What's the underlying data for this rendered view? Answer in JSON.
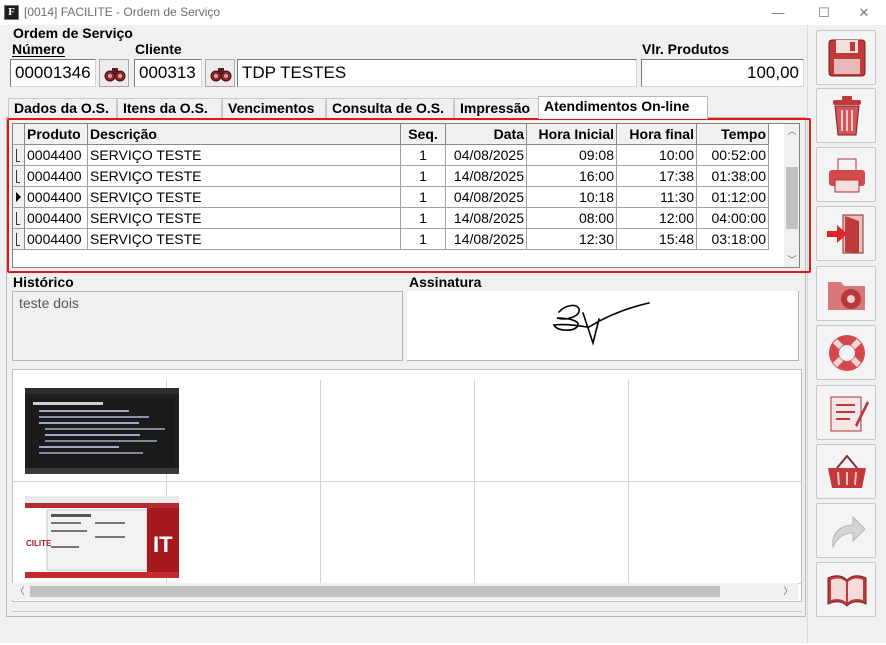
{
  "window": {
    "title": "[0014] FACILITE - Ordem de Serviço",
    "app_icon_letter": "F",
    "minimize_label": "—",
    "maximize_label": "☐",
    "close_label": "✕"
  },
  "form": {
    "section_title": "Ordem de Serviço",
    "numero_label": "Número",
    "numero_value": "00001346",
    "cliente_label": "Cliente",
    "cliente_code": "000313",
    "cliente_name": "TDP TESTES",
    "vlr_produtos_label": "Vlr. Produtos",
    "vlr_produtos_value": "100,00"
  },
  "tabs": [
    {
      "label": "Dados da O.S."
    },
    {
      "label": "Itens da O.S."
    },
    {
      "label": "Vencimentos"
    },
    {
      "label": "Consulta de O.S."
    },
    {
      "label": "Impressão"
    },
    {
      "label": "Atendimentos On-line"
    }
  ],
  "grid": {
    "columns": [
      "Produto",
      "Descrição",
      "Seq.",
      "Data",
      "Hora Inicial",
      "Hora final",
      "Tempo"
    ],
    "rows": [
      [
        "0004400",
        "SERVIÇO TESTE",
        "1",
        "04/08/2025",
        "09:08",
        "10:00",
        "00:52:00"
      ],
      [
        "0004400",
        "SERVIÇO TESTE",
        "1",
        "14/08/2025",
        "16:00",
        "17:38",
        "01:38:00"
      ],
      [
        "0004400",
        "SERVIÇO TESTE",
        "1",
        "04/08/2025",
        "10:18",
        "11:30",
        "01:12:00"
      ],
      [
        "0004400",
        "SERVIÇO TESTE",
        "1",
        "14/08/2025",
        "08:00",
        "12:00",
        "04:00:00"
      ],
      [
        "0004400",
        "SERVIÇO TESTE",
        "1",
        "14/08/2025",
        "12:30",
        "15:48",
        "03:18:00"
      ]
    ],
    "current_row": 2
  },
  "historico": {
    "label": "Histórico",
    "text": "teste dois"
  },
  "assinatura": {
    "label": "Assinatura"
  },
  "sidebar": [
    {
      "icon": "save-icon"
    },
    {
      "icon": "trash-icon"
    },
    {
      "icon": "printer-icon"
    },
    {
      "icon": "exit-door-icon"
    },
    {
      "icon": "folder-settings-icon"
    },
    {
      "icon": "lifebuoy-icon"
    },
    {
      "icon": "notepad-icon"
    },
    {
      "icon": "basket-icon"
    },
    {
      "icon": "redo-arrow-icon"
    },
    {
      "icon": "book-icon"
    }
  ],
  "colors": {
    "accent_red": "#c0393b",
    "highlight_frame": "#e3161b"
  }
}
